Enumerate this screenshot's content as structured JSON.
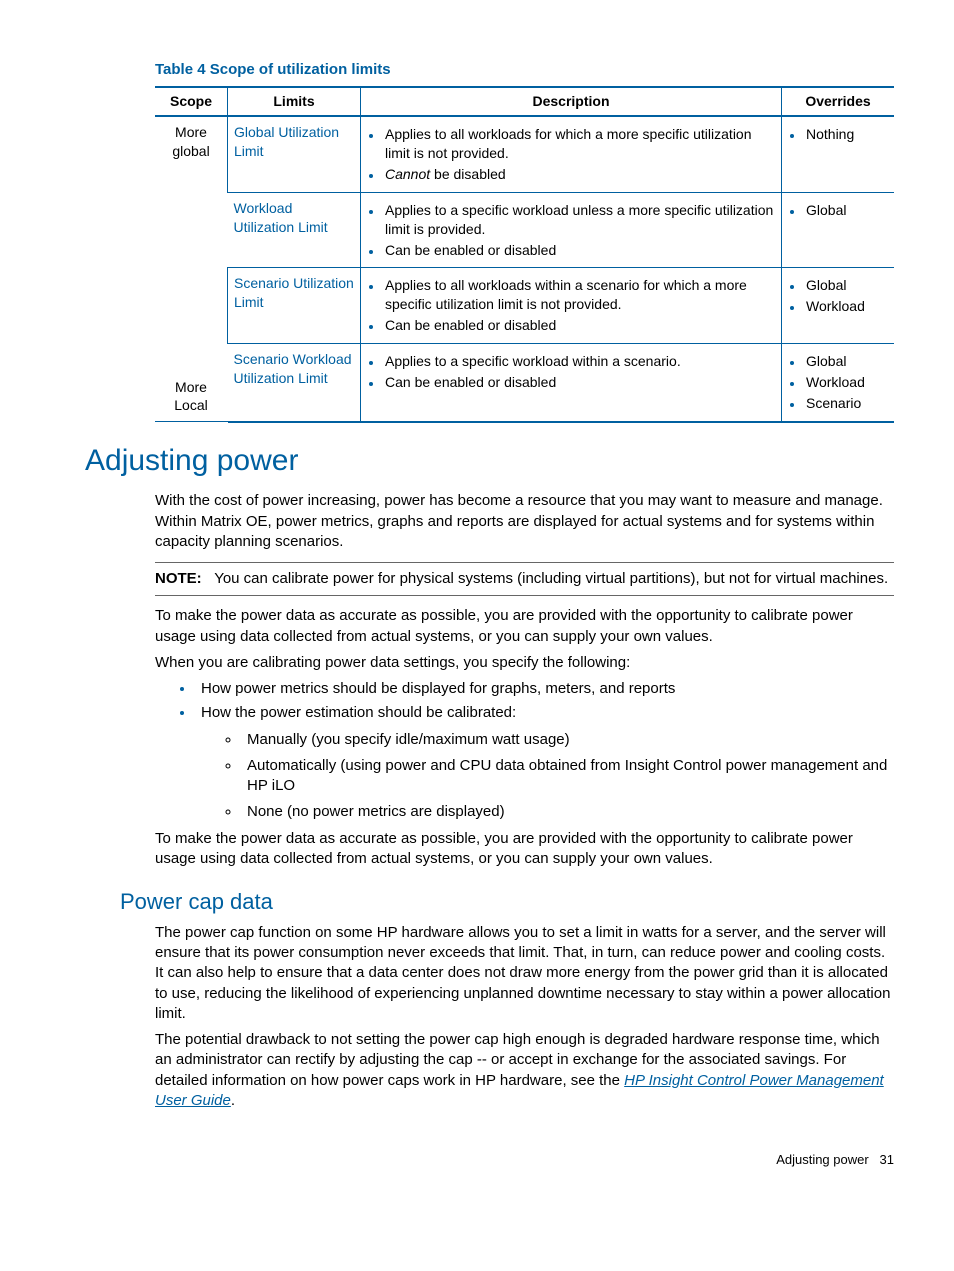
{
  "table": {
    "caption": "Table 4 Scope of utilization limits",
    "headers": {
      "scope": "Scope",
      "limits": "Limits",
      "description": "Description",
      "overrides": "Overrides"
    },
    "rows": [
      {
        "scope": "More global",
        "limit": "Global Utilization Limit",
        "desc": [
          "Applies to all workloads for which a more specific utilization limit is not provided.",
          "Cannot be disabled"
        ],
        "desc_em_first_word_1": "Cannot",
        "desc_rest_1": " be disabled",
        "overrides": [
          "Nothing"
        ]
      },
      {
        "scope": "",
        "limit": "Workload Utilization Limit",
        "desc": [
          "Applies to a specific workload unless a more specific utilization limit is provided.",
          "Can be enabled or disabled"
        ],
        "overrides": [
          "Global"
        ]
      },
      {
        "scope": "",
        "limit": "Scenario Utilization Limit",
        "desc": [
          "Applies to all workloads within a scenario for which a more specific utilization limit is not provided.",
          "Can be enabled or disabled"
        ],
        "overrides": [
          "Global",
          "Workload"
        ]
      },
      {
        "scope": "More Local",
        "limit": "Scenario Workload Utilization Limit",
        "desc": [
          "Applies to a specific workload within a scenario.",
          "Can be enabled or disabled"
        ],
        "overrides": [
          "Global",
          "Workload",
          "Scenario"
        ]
      }
    ]
  },
  "h1": "Adjusting power",
  "p_intro": "With the cost of power increasing, power has become a resource that you may want to measure and manage. Within Matrix OE, power metrics, graphs and reports are displayed for actual systems and for systems within capacity planning scenarios.",
  "note": {
    "label": "NOTE:",
    "text": "You can calibrate power for physical systems (including virtual partitions), but not for virtual machines."
  },
  "p_calibrate1": "To make the power data as accurate as possible, you are provided with the opportunity to calibrate power usage using data collected from actual systems, or you can supply your own values.",
  "p_calibrate2": "When you are calibrating power data settings, you specify the following:",
  "bullets": {
    "b1": "How power metrics should be displayed for graphs, meters, and reports",
    "b2": "How the power estimation should be calibrated:",
    "sub1": "Manually (you specify idle/maximum watt usage)",
    "sub2": "Automatically (using power and CPU data obtained from Insight Control power management and HP iLO",
    "sub3": "None (no power metrics are displayed)"
  },
  "p_calibrate3": "To make the power data as accurate as possible, you are provided with the opportunity to calibrate power usage using data collected from actual systems, or you can supply your own values.",
  "h2": "Power cap data",
  "p_cap1": "The power cap function on some HP hardware allows you to set a limit in watts for a server, and the server will ensure that its power consumption never exceeds that limit. That, in turn, can reduce power and cooling costs. It can also help to ensure that a data center does not draw more energy from the power grid than it is allocated to use, reducing the likelihood of experiencing unplanned downtime necessary to stay within a power allocation limit.",
  "p_cap2_a": "The potential drawback to not setting the power cap high enough is degraded hardware response time, which an administrator can rectify by adjusting the cap -- or accept in exchange for the associated savings. For detailed information on how power caps work in HP hardware, see the ",
  "p_cap2_link": "HP Insight Control Power Management User Guide",
  "p_cap2_b": ".",
  "footer": {
    "section": "Adjusting power",
    "page": "31"
  }
}
